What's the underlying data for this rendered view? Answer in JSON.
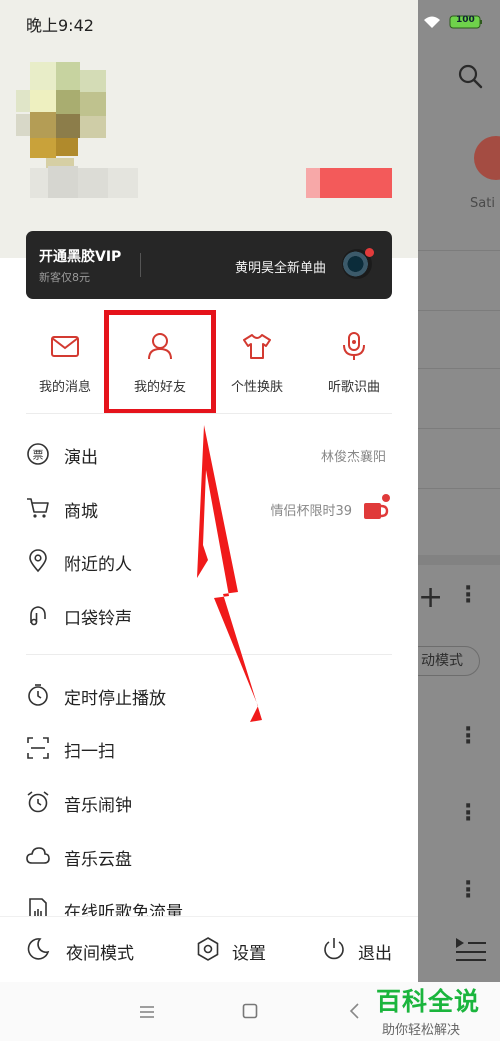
{
  "status_bar": {
    "time": "晚上9:42",
    "battery": "100"
  },
  "background_app": {
    "tab_label": "Sati",
    "mode_label": "动模式"
  },
  "vip_banner": {
    "title": "开通黑胶VIP",
    "subtitle": "新客仅8元",
    "promo": "黄明昊全新单曲"
  },
  "quick_actions": [
    {
      "label": "我的消息",
      "icon": "mail-icon"
    },
    {
      "label": "我的好友",
      "icon": "person-icon"
    },
    {
      "label": "个性换肤",
      "icon": "tshirt-icon"
    },
    {
      "label": "听歌识曲",
      "icon": "mic-icon"
    }
  ],
  "menu": [
    {
      "label": "演出",
      "right": "林俊杰襄阳",
      "icon": "ticket-icon"
    },
    {
      "label": "商城",
      "right": "情侣杯限时39",
      "icon": "cart-icon"
    },
    {
      "label": "附近的人",
      "icon": "location-icon"
    },
    {
      "label": "口袋铃声",
      "icon": "ringtone-icon"
    },
    {
      "label": "定时停止播放",
      "icon": "timer-icon"
    },
    {
      "label": "扫一扫",
      "icon": "scan-icon"
    },
    {
      "label": "音乐闹钟",
      "icon": "alarm-icon"
    },
    {
      "label": "音乐云盘",
      "icon": "cloud-icon"
    },
    {
      "label": "在线听歌免流量",
      "icon": "sim-icon"
    }
  ],
  "bottom_bar": [
    {
      "label": "夜间模式",
      "icon": "moon-icon"
    },
    {
      "label": "设置",
      "icon": "settings-icon"
    },
    {
      "label": "退出",
      "icon": "power-icon"
    }
  ],
  "watermark": {
    "title": "百科全说",
    "subtitle": "助你轻松解决"
  },
  "colors": {
    "accent_red": "#e5131b",
    "brand_red": "#d33a31",
    "watermark_green": "#1bb53d"
  }
}
